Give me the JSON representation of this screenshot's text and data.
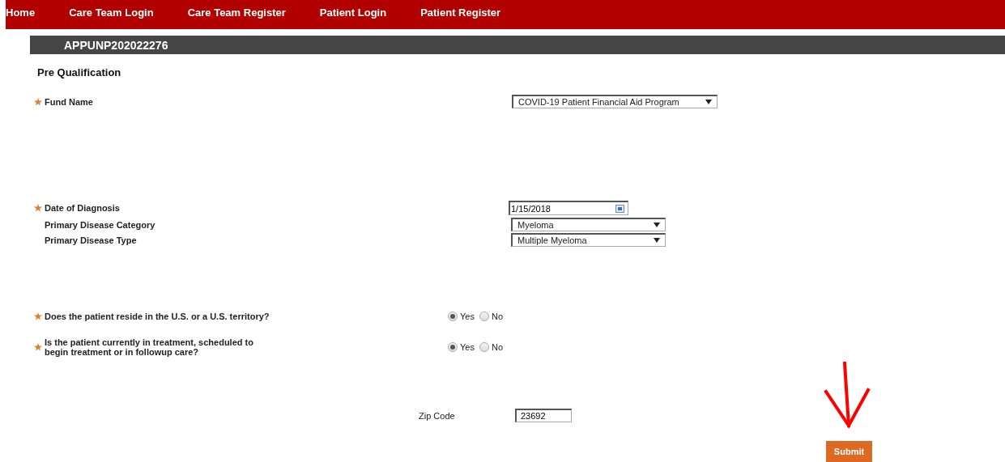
{
  "nav": [
    {
      "label": "Home"
    },
    {
      "label": "Care Team Login"
    },
    {
      "label": "Care Team Register"
    },
    {
      "label": "Patient Login"
    },
    {
      "label": "Patient Register"
    }
  ],
  "app_id": "APPUNP202022276",
  "section_title": "Pre Qualification",
  "fields": [
    {
      "kind": "select",
      "label": "Fund Name",
      "required": true,
      "value": "COVID-19 Patient Financial Aid Program"
    },
    {
      "kind": "date",
      "label": "Date of Diagnosis",
      "required": true,
      "value": "1/15/2018"
    },
    {
      "kind": "select",
      "label": "Primary Disease Category",
      "required": false,
      "value": "Myeloma"
    },
    {
      "kind": "select",
      "label": "Primary Disease Type",
      "required": false,
      "value": "Multiple Myeloma"
    },
    {
      "kind": "radio",
      "label": "Does the patient reside in the U.S. or a U.S. territory?",
      "required": true,
      "options": [
        {
          "label": "Yes",
          "selected": true
        },
        {
          "label": "No",
          "selected": false
        }
      ]
    },
    {
      "kind": "radio",
      "label": "Is the patient currently in treatment, scheduled to begin treatment or in followup care?",
      "required": true,
      "options": [
        {
          "label": "Yes",
          "selected": true
        },
        {
          "label": "No",
          "selected": false
        }
      ]
    }
  ],
  "zip": {
    "label": "Zip Code",
    "value": "23692"
  },
  "submit": "Submit"
}
